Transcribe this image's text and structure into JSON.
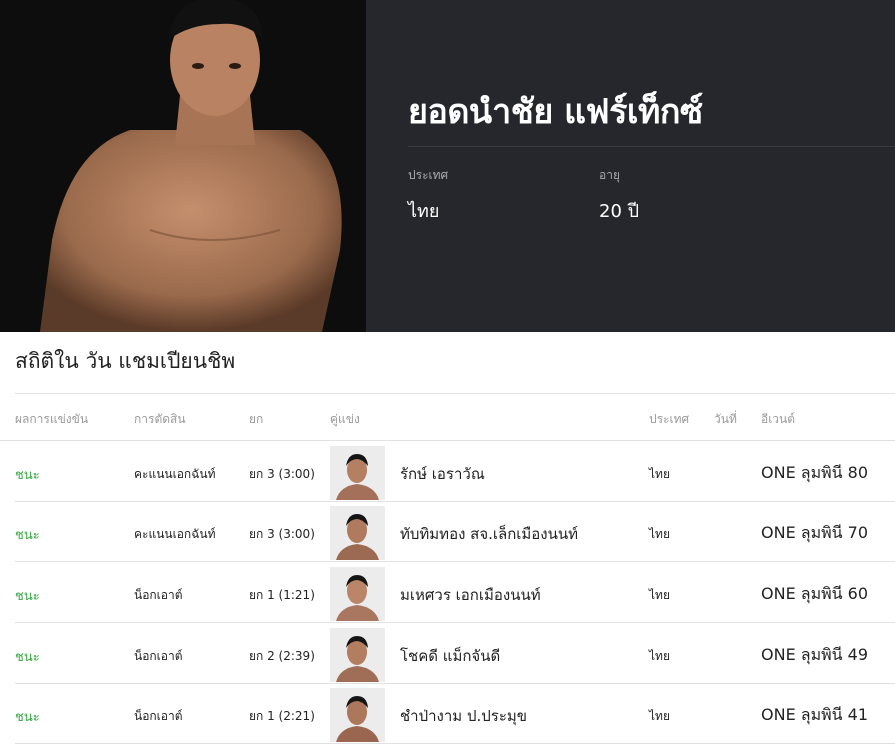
{
  "fighter": {
    "name": "ยอดนำชัย แฟร์เท็กซ์",
    "photo_icon": "fighter-portrait",
    "country_label": "ประเทศ",
    "country_value": "ไทย",
    "age_label": "อายุ",
    "age_value": "20 ปี"
  },
  "stats": {
    "title": "สถิติใน วัน แชมเปียนชิพ",
    "headers": {
      "result": "ผลการแข่งขัน",
      "method": "การตัดสิน",
      "round": "ยก",
      "opponent": "คู่แข่ง",
      "country": "ประเทศ",
      "date": "วันที่",
      "event": "อีเวนต์"
    },
    "rows": [
      {
        "result": "ชนะ",
        "method": "คะแนนเอกฉันท์",
        "round": "ยก 3 (3:00)",
        "opponent": "รักษ์ เอราวัณ",
        "country": "ไทย",
        "event": "ONE ลุมพินี 80"
      },
      {
        "result": "ชนะ",
        "method": "คะแนนเอกฉันท์",
        "round": "ยก 3 (3:00)",
        "opponent": "ทับทิมทอง สจ.เล็กเมืองนนท์",
        "country": "ไทย",
        "event": "ONE ลุมพินี 70"
      },
      {
        "result": "ชนะ",
        "method": "น็อกเอาต์",
        "round": "ยก 1 (1:21)",
        "opponent": "มเหศวร เอกเมืองนนท์",
        "country": "ไทย",
        "event": "ONE ลุมพินี 60"
      },
      {
        "result": "ชนะ",
        "method": "น็อกเอาต์",
        "round": "ยก 2 (2:39)",
        "opponent": "โชคดี แม็กจันดี",
        "country": "ไทย",
        "event": "ONE ลุมพินี 49"
      },
      {
        "result": "ชนะ",
        "method": "น็อกเอาต์",
        "round": "ยก 1 (2:21)",
        "opponent": "ชำป่างาม ป.ประมุข",
        "country": "ไทย",
        "event": "ONE ลุมพินี 41"
      }
    ]
  },
  "colors": {
    "win": "#39a845",
    "hero_bg": "#26272d",
    "photo_bg": "#0d0d0d"
  }
}
